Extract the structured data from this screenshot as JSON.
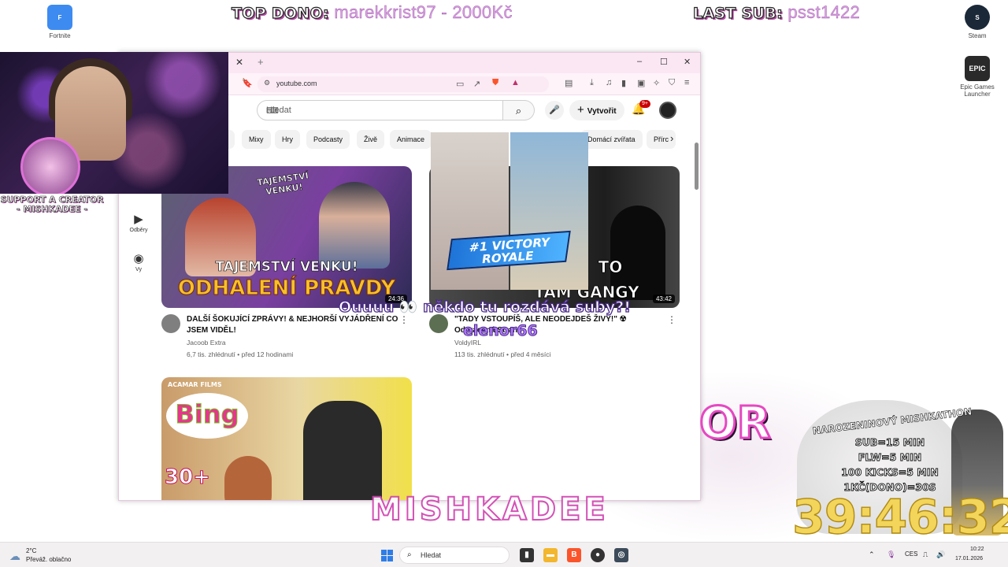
{
  "stream": {
    "top_dono_label": "TOP DONO:",
    "top_dono_value": "marekkrist97 - 2000Kč",
    "last_sub_label": "LAST SUB:",
    "last_sub_value": "psst1422",
    "support_line1": "SUPPORT A CREATOR",
    "support_line2": "- MISHKADEE -",
    "alert_text": "Ouuuu 👀 někdo tu rozdává suby?!",
    "alert_name": "elenor66",
    "big_or": "OR",
    "big_name": "MISHKADEE",
    "event_title": "NAROZENINOVÝ MISHKATHON",
    "event_rules": [
      "SUB=15 MIN",
      "FLW=5 MIN",
      "100 KICKS=5 MIN",
      "1KČ(DONO)=30S"
    ],
    "timer": "39:46:32"
  },
  "desktop": {
    "icons": [
      {
        "label": "Fortnite",
        "icon": "fortnite-icon",
        "tile": "F"
      },
      {
        "label": "Steam",
        "icon": "steam-icon",
        "tile": "S"
      },
      {
        "label": "Epic Games Launcher",
        "icon": "epic-games-icon",
        "tile": "EPIC"
      }
    ]
  },
  "browser": {
    "url": "youtube.com",
    "tab_close": "✕",
    "new_tab": "+",
    "win_minimize": "–",
    "win_maximize": "☐",
    "win_close": "✕"
  },
  "youtube": {
    "search_placeholder": "Hledat",
    "create_label": "Vytvořit",
    "notifications_badge": "9+",
    "chips": [
      "a",
      "Mixy",
      "Hry",
      "Podcasty",
      "Živě",
      "Animace",
      "Domácí zvířata",
      "Přírc"
    ],
    "sidebar": [
      {
        "label": "Odběry",
        "icon": "subscriptions-icon"
      },
      {
        "label": "Vy",
        "icon": "account-icon"
      }
    ],
    "videos": [
      {
        "title": "DALŠÍ ŠOKUJÍCÍ ZPRÁVY! & NEJHORŠÍ VYJÁDŘENÍ CO JSEM VIDĚL!",
        "channel": "Jacoob Extra",
        "stats": "6,7 tis. zhlédnutí • před 12 hodinami",
        "duration": "24:36",
        "thumb_text_1": "TAJEMSTVÍ VENKU!",
        "thumb_text_2": "TAJEMSTVÍ VENKU!",
        "thumb_text_3": "ODHALENÍ PRAVDY"
      },
      {
        "title": "\"TADY VSTOUPÍŠ, ALE NEODEJDEŠ ŽIVÝ!\" ☢ Odvrácená Strana",
        "channel": "VoldyIRL",
        "stats": "113 tis. zhlédnutí • před 4 měsíci",
        "duration": "43:42",
        "thumb_text_1": "TO",
        "thumb_text_2": "TAM GANGY"
      },
      {
        "title": "",
        "channel": "",
        "stats": "",
        "thumb_brand": "ACAMAR FILMS",
        "thumb_logo": "Bing",
        "thumb_badge": "30+"
      }
    ]
  },
  "clip_overlay": {
    "victory_line1": "#1 VICTORY",
    "victory_line2": "ROYALE"
  },
  "taskbar": {
    "weather_temp": "2°C",
    "weather_desc": "Převáž. oblačno",
    "search_placeholder": "Hledat",
    "language": "CES",
    "time": "10:22",
    "date": "17.01.2026"
  },
  "colors": {
    "yt_red": "#cc0000",
    "overlay_pink": "#d9a4e2",
    "timer_yellow": "#f2d55a",
    "browser_frame": "#fbe7f4"
  }
}
